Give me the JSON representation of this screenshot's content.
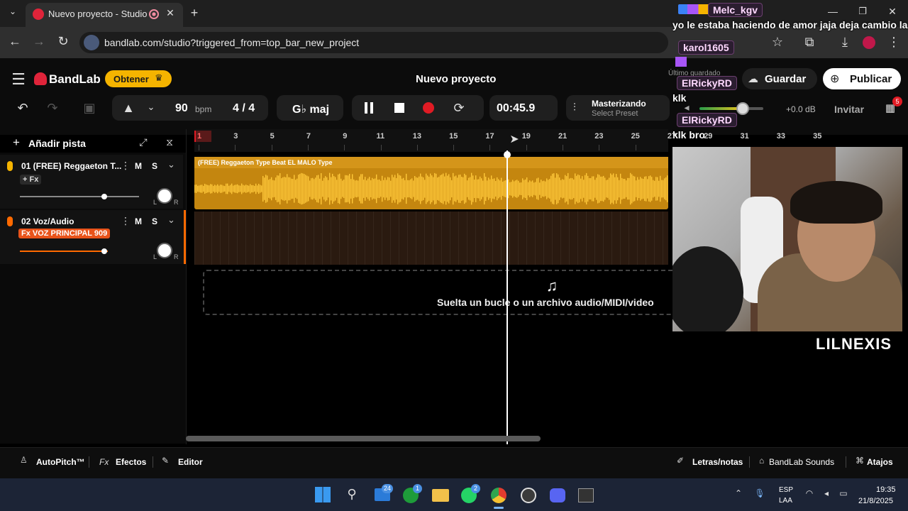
{
  "browser": {
    "tab_title": "Nuevo proyecto - Studio",
    "url": "bandlab.com/studio?triggered_from=top_bar_new_project"
  },
  "app": {
    "logo": "BandLab",
    "get_label": "Obtener",
    "project_title": "Nuevo proyecto",
    "last_saved": "Último guardado",
    "save_label": "Guardar",
    "publish_label": "Publicar",
    "invite_label": "Invitar",
    "badge_count": "5"
  },
  "transport": {
    "bpm_value": "90",
    "bpm_unit": "bpm",
    "time_sig": "4 / 4",
    "key": "G♭ maj",
    "time": "00:45.9",
    "mastering_title": "Masterizando",
    "mastering_preset": "Select Preset",
    "volume_db": "+0.0 dB"
  },
  "ruler": {
    "marks": [
      "1",
      "3",
      "5",
      "7",
      "9",
      "11",
      "13",
      "15",
      "17",
      "19",
      "21",
      "23",
      "25",
      "27",
      "29",
      "31",
      "33",
      "35"
    ]
  },
  "tracks": {
    "add_label": "Añadir pista",
    "items": [
      {
        "name": "01  (FREE) Reggaeton T...",
        "fx": "+ Fx",
        "mute": "M",
        "solo": "S"
      },
      {
        "name": "02  Voz/Audio",
        "fx": "Fx VOZ PRINCIPAL 909",
        "mute": "M",
        "solo": "S"
      }
    ],
    "clip_name": "(FREE) Reggaeton Type Beat EL MALO  Type",
    "drop_hint": "Suelta un bucle o un archivo audio/MIDI/video"
  },
  "bottom": {
    "autopitch": "AutoPitch™",
    "effects_prefix": "Fx",
    "effects": "Efectos",
    "editor": "Editor",
    "lyrics": "Letras/notas",
    "sounds": "BandLab Sounds",
    "shortcuts": "Atajos"
  },
  "overlay": {
    "chat": [
      {
        "user": "Melc_kgv",
        "msg": "yo le estaba haciendo de amor jaja deja cambio la letra"
      },
      {
        "user": "karol1605",
        "msg": ""
      },
      {
        "user": "ElRickyRD",
        "msg": "klk"
      },
      {
        "user": "ElRickyRD",
        "msg": "klk bro"
      }
    ],
    "streamer": "LILNEXIS"
  },
  "taskbar": {
    "lang1": "ESP",
    "lang2": "LAA",
    "time": "19:35",
    "date": "21/8/2025",
    "badge_mail": "24",
    "badge_xbox": "1",
    "badge_wa": "2"
  },
  "colors": {
    "accent": "#f5b400",
    "record": "#e01b24",
    "clip": "#c4860f",
    "track2_accent": "#ff6a00"
  }
}
